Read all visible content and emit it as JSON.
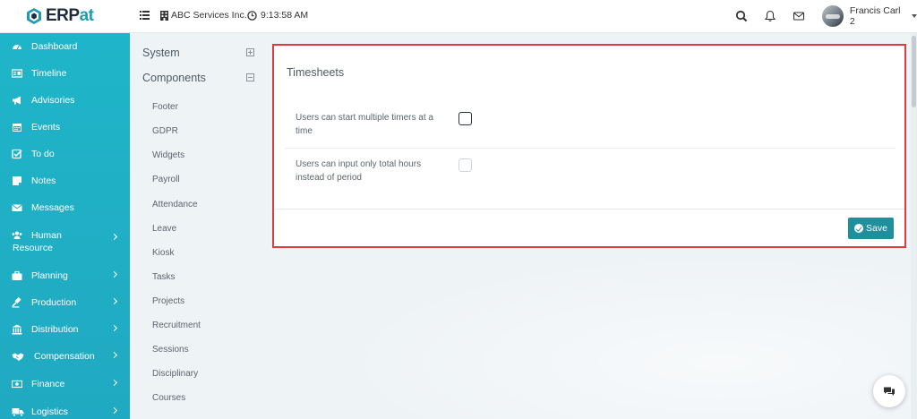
{
  "brand": {
    "logo_prefix": "ERP",
    "logo_suffix": "at"
  },
  "header": {
    "company": "ABC Services Inc.",
    "time": "9:13:58 AM",
    "user_name": "Francis Carl 2"
  },
  "sidebar": {
    "items": [
      {
        "label": "Dashboard",
        "icon": "dashboard-icon"
      },
      {
        "label": "Timeline",
        "icon": "timeline-icon"
      },
      {
        "label": "Advisories",
        "icon": "megaphone-icon"
      },
      {
        "label": "Events",
        "icon": "calendar-icon"
      },
      {
        "label": "To do",
        "icon": "checkbox-icon"
      },
      {
        "label": "Notes",
        "icon": "note-icon"
      },
      {
        "label": "Messages",
        "icon": "envelope-icon"
      },
      {
        "label": "Human",
        "label2": "Resource",
        "icon": "users-icon"
      },
      {
        "label": "Planning",
        "icon": "briefcase-icon"
      },
      {
        "label": "Production",
        "icon": "gavel-icon"
      },
      {
        "label": "Distribution",
        "icon": "bank-icon"
      },
      {
        "label": "Compensation",
        "icon": "handshake-icon"
      },
      {
        "label": "Finance",
        "icon": "money-icon"
      },
      {
        "label": "Logistics",
        "icon": "truck-icon"
      }
    ]
  },
  "settings_nav": {
    "system": "System",
    "components": "Components",
    "items": [
      "Footer",
      "GDPR",
      "Widgets",
      "Payroll",
      "Attendance",
      "Leave",
      "Kiosk",
      "Tasks",
      "Projects",
      "Recruitment",
      "Sessions",
      "Disciplinary",
      "Courses"
    ]
  },
  "card": {
    "title": "Timesheets",
    "rows": [
      {
        "label": "Users can start multiple timers at a time",
        "checked": false
      },
      {
        "label": "Users can input only total hours instead of period",
        "checked": false
      }
    ],
    "save_label": "Save"
  },
  "colors": {
    "sidebar": "#1fb5c9",
    "accent": "#1f8f9e",
    "highlight_border": "#e0393e"
  }
}
